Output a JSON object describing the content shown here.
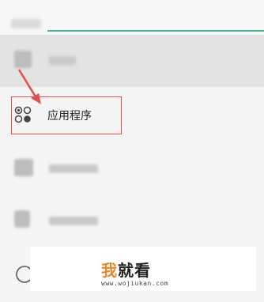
{
  "menu": {
    "apps_label": "应用程序"
  },
  "watermark": {
    "brand_char1": "我",
    "brand_rest": "就看",
    "url": "www.wojiukan.com"
  },
  "colors": {
    "accent_line": "#4fb08f",
    "highlight_box": "#e74c4c",
    "arrow": "#e74c4c",
    "watermark_orange": "#e8862a"
  }
}
